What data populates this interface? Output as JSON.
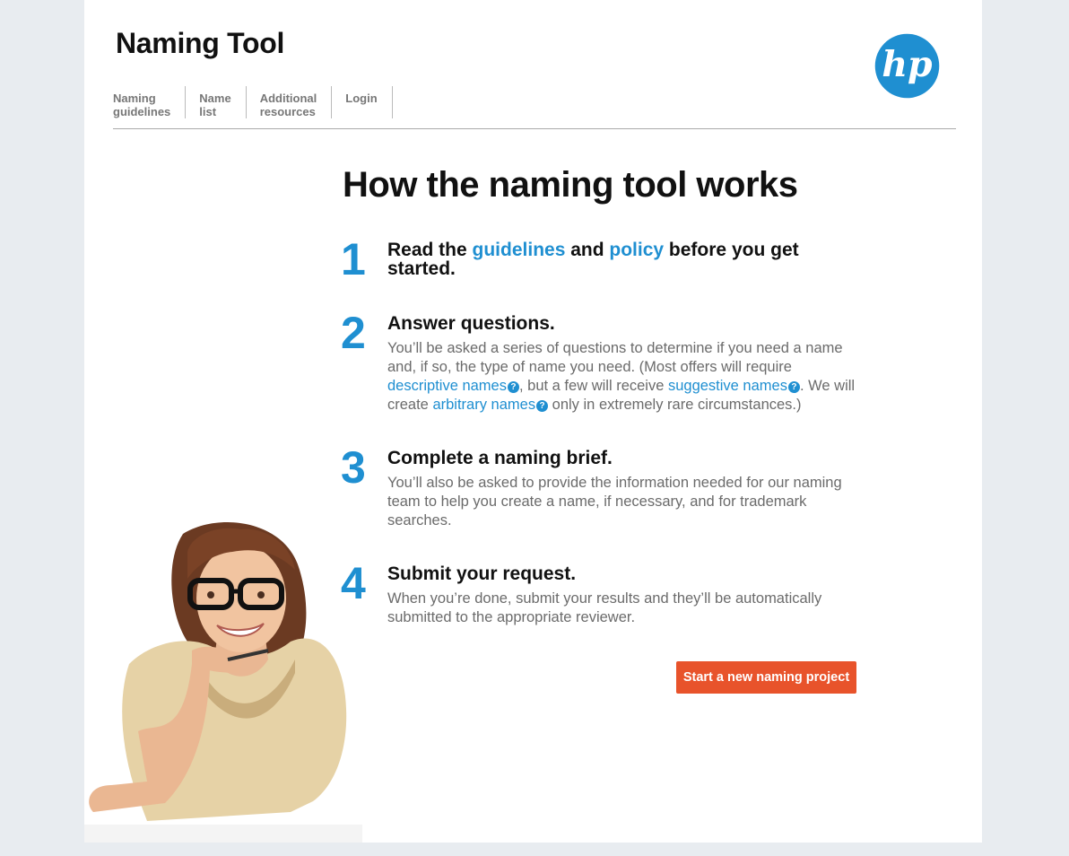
{
  "app": {
    "title": "Naming Tool"
  },
  "logo": {
    "text": "hp",
    "color": "#1f8fd1"
  },
  "nav": {
    "items": [
      {
        "label": "Naming\nguidelines"
      },
      {
        "label": "Name\nlist"
      },
      {
        "label": "Additional\nresources"
      },
      {
        "label": "Login"
      }
    ]
  },
  "main": {
    "heading": "How the naming tool works",
    "steps": [
      {
        "number": "1",
        "title_parts": [
          "Read the ",
          "guidelines",
          " and ",
          "policy",
          " before you get started."
        ]
      },
      {
        "number": "2",
        "title": "Answer questions.",
        "text_parts": [
          "You’ll be asked a series of questions to determine if you need a name and, if so, the type of name you need. (Most offers will require ",
          "descriptive names",
          ", but a few will receive ",
          "suggestive names",
          ". We will create ",
          "arbitrary names",
          " only in extremely rare circumstances.)"
        ]
      },
      {
        "number": "3",
        "title": "Complete a naming brief.",
        "text": "You’ll also be asked to provide the information needed for our naming team to help you create a name, if necessary, and for trademark searches."
      },
      {
        "number": "4",
        "title": "Submit your request.",
        "text": "When you’re done, submit your results and they’ll be automatically submitted to the appropriate reviewer."
      }
    ],
    "help_icon": "?",
    "cta_label": "Start a new naming project"
  },
  "colors": {
    "accent": "#1f8fd1",
    "cta": "#e8532b",
    "background": "#e8ecf0"
  },
  "icons": {
    "logo": "hp-logo-icon",
    "help": "question-circle-icon"
  }
}
